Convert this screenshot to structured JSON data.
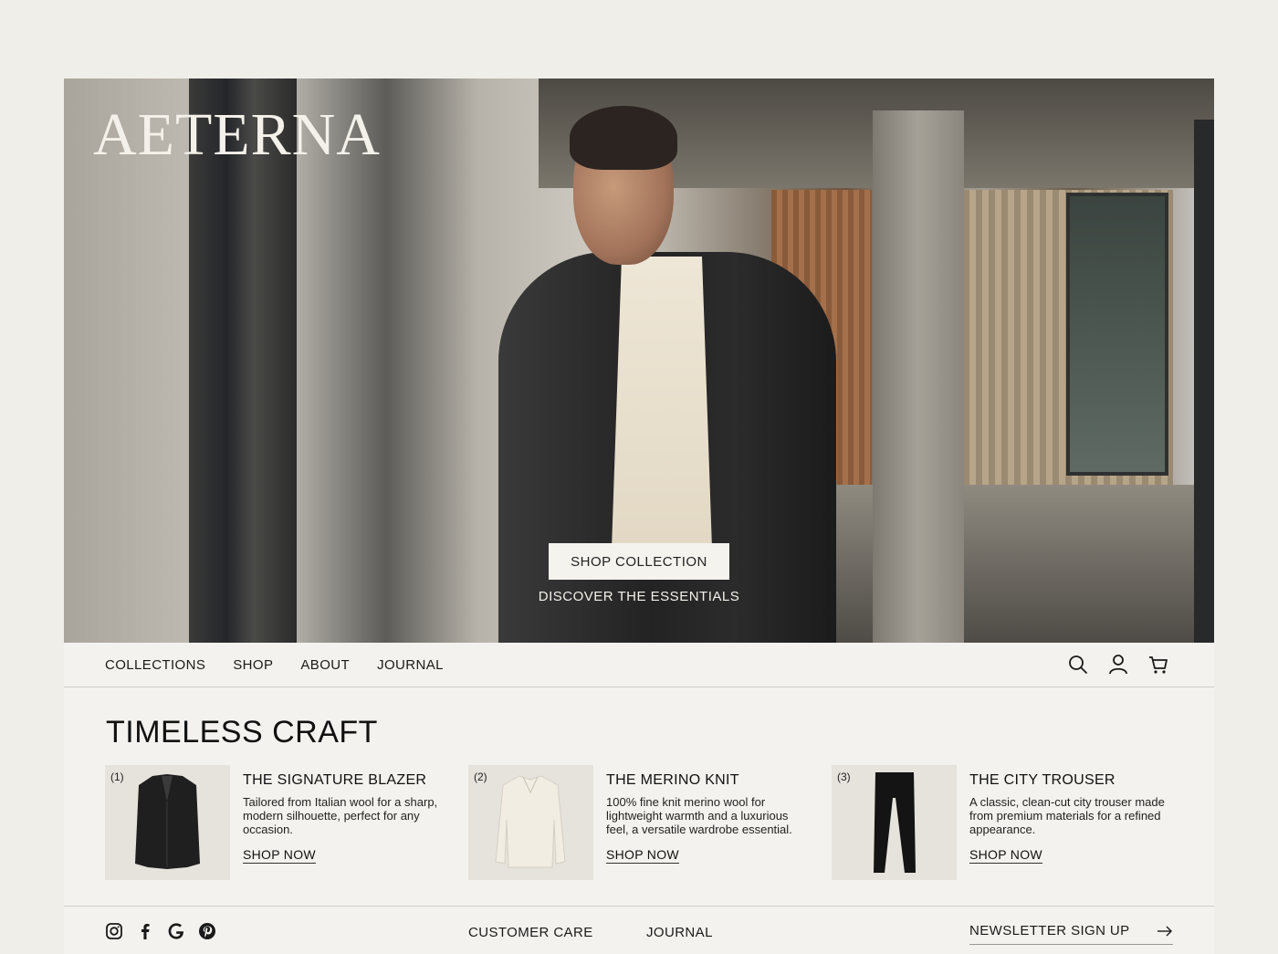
{
  "brand": {
    "logo": "AETERNA"
  },
  "hero": {
    "cta_label": "SHOP COLLECTION",
    "sub_label": "DISCOVER THE ESSENTIALS"
  },
  "nav": {
    "items": [
      {
        "label": "COLLECTIONS"
      },
      {
        "label": "SHOP"
      },
      {
        "label": "ABOUT"
      },
      {
        "label": "JOURNAL"
      }
    ],
    "icons": [
      "search-icon",
      "account-icon",
      "cart-icon"
    ]
  },
  "section": {
    "title": "TIMELESS CRAFT"
  },
  "products": [
    {
      "num": "(1)",
      "name": "THE SIGNATURE BLAZER",
      "desc": "Tailored from Italian wool for a sharp, modern silhouette, perfect for any occasion.",
      "cta": "SHOP NOW"
    },
    {
      "num": "(2)",
      "name": "THE MERINO KNIT",
      "desc": "100% fine knit merino wool for lightweight warmth and a luxurious feel, a versatile wardrobe essential.",
      "cta": "SHOP NOW"
    },
    {
      "num": "(3)",
      "name": "THE CITY TROUSER",
      "desc": "A classic, clean-cut city trouser made from premium materials for a refined appearance.",
      "cta": "SHOP NOW"
    }
  ],
  "footer": {
    "social_icons": [
      "instagram-icon",
      "facebook-icon",
      "google-icon",
      "pinterest-icon"
    ],
    "customer_care": "CUSTOMER CARE",
    "journal": "JOURNAL",
    "newsletter": "NEWSLETTER SIGN UP"
  },
  "colors": {
    "background": "#efeee9",
    "panel": "#f3f2ee",
    "text": "#1a1a1a",
    "cta_bg": "#f5f3ee"
  }
}
